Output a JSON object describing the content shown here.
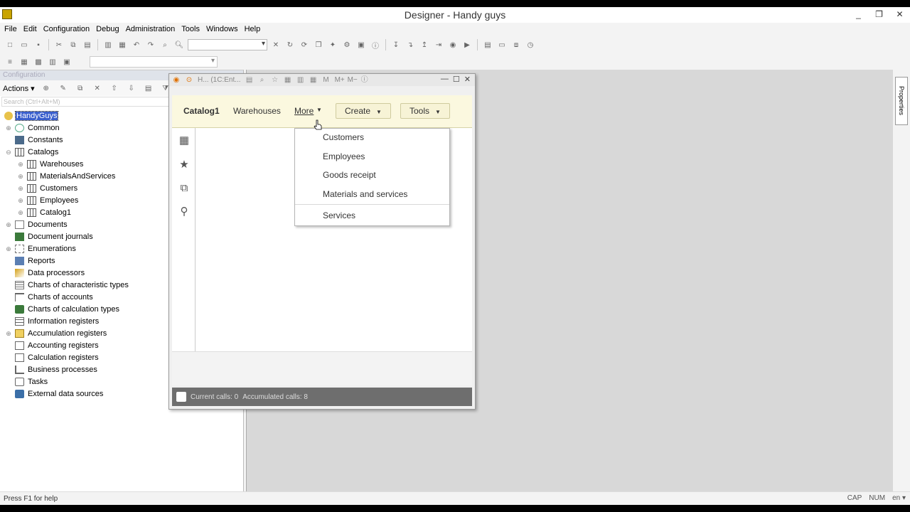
{
  "window": {
    "title": "Designer - Handy guys",
    "minimize": "_",
    "restore": "❐",
    "close": "✕"
  },
  "menu": [
    "File",
    "Edit",
    "Configuration",
    "Debug",
    "Administration",
    "Tools",
    "Windows",
    "Help"
  ],
  "left_pane": {
    "header": "Configuration",
    "actions_label": "Actions",
    "search_placeholder": "Search (Ctrl+Alt+M)",
    "root": "HandyGuys",
    "tree": [
      "Common",
      "Constants",
      "Catalogs",
      "Warehouses",
      "MaterialsAndServices",
      "Customers",
      "Employees",
      "Catalog1",
      "Documents",
      "Document journals",
      "Enumerations",
      "Reports",
      "Data processors",
      "Charts of characteristic types",
      "Charts of accounts",
      "Charts of calculation types",
      "Information registers",
      "Accumulation registers",
      "Accounting registers",
      "Calculation registers",
      "Business processes",
      "Tasks",
      "External data sources"
    ]
  },
  "right_panel": {
    "properties_tab": "Properties"
  },
  "enterprise": {
    "title": "H... (1C:Ent...",
    "sections": {
      "catalog1": "Catalog1",
      "warehouses": "Warehouses",
      "more": "More"
    },
    "buttons": {
      "create": "Create",
      "tools": "Tools"
    },
    "status": {
      "current": "Current calls: 0",
      "accumulated": "Accumulated calls: 8"
    },
    "dropdown": [
      "Customers",
      "Employees",
      "Goods receipt",
      "Materials and services",
      "Services"
    ]
  },
  "statusbar": {
    "help": "Press F1 for help",
    "cap": "CAP",
    "num": "NUM",
    "lang": "en"
  }
}
